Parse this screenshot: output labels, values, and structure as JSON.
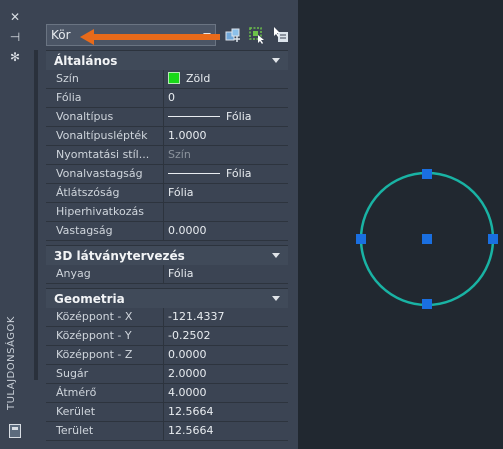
{
  "strip": {
    "close_icon": "✕",
    "pin_icon": "⊣",
    "settings_icon": "✻",
    "title": "TULAJDONSÁGOK"
  },
  "selector": {
    "value": "Kör"
  },
  "sections": {
    "general": {
      "title": "Általános",
      "rows": [
        {
          "label": "Szín",
          "value": "Zöld"
        },
        {
          "label": "Fólia",
          "value": "0"
        },
        {
          "label": "Vonaltípus",
          "value": "Fólia"
        },
        {
          "label": "Vonaltípuslépték",
          "value": "1.0000"
        },
        {
          "label": "Nyomtatási stíl...",
          "value": "Szín"
        },
        {
          "label": "Vonalvastagság",
          "value": "Fólia"
        },
        {
          "label": "Átlátszóság",
          "value": "Fólia"
        },
        {
          "label": "Hiperhivatkozás",
          "value": ""
        },
        {
          "label": "Vastagság",
          "value": "0.0000"
        }
      ]
    },
    "visualization": {
      "title": "3D látványtervezés",
      "rows": [
        {
          "label": "Anyag",
          "value": "Fólia"
        }
      ]
    },
    "geometry": {
      "title": "Geometria",
      "rows": [
        {
          "label": "Középpont - X",
          "value": "-121.4337"
        },
        {
          "label": "Középpont - Y",
          "value": "-0.2502"
        },
        {
          "label": "Középpont - Z",
          "value": "0.0000"
        },
        {
          "label": "Sugár",
          "value": "2.0000"
        },
        {
          "label": "Átmérő",
          "value": "4.0000"
        },
        {
          "label": "Kerület",
          "value": "12.5664"
        },
        {
          "label": "Terület",
          "value": "12.5664"
        }
      ]
    }
  },
  "colors": {
    "swatch": "#18d918",
    "circle": "#19b3a4",
    "grip": "#1a6fe0",
    "arrow": "#e86a1a"
  }
}
